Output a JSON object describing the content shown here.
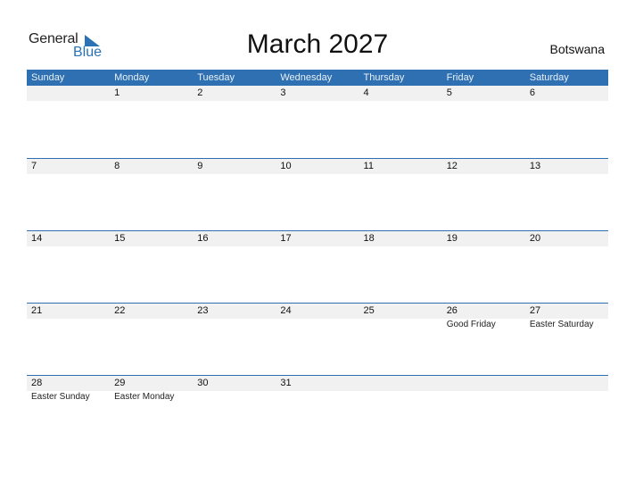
{
  "logo": {
    "word1": "General",
    "word2": "Blue"
  },
  "title": "March 2027",
  "country": "Botswana",
  "colors": {
    "accent": "#2e70b1",
    "strip": "#f1f1f1"
  },
  "weekdays": [
    "Sunday",
    "Monday",
    "Tuesday",
    "Wednesday",
    "Thursday",
    "Friday",
    "Saturday"
  ],
  "weeks": [
    [
      {
        "day": ""
      },
      {
        "day": "1"
      },
      {
        "day": "2"
      },
      {
        "day": "3"
      },
      {
        "day": "4"
      },
      {
        "day": "5"
      },
      {
        "day": "6"
      }
    ],
    [
      {
        "day": "7"
      },
      {
        "day": "8"
      },
      {
        "day": "9"
      },
      {
        "day": "10"
      },
      {
        "day": "11"
      },
      {
        "day": "12"
      },
      {
        "day": "13"
      }
    ],
    [
      {
        "day": "14"
      },
      {
        "day": "15"
      },
      {
        "day": "16"
      },
      {
        "day": "17"
      },
      {
        "day": "18"
      },
      {
        "day": "19"
      },
      {
        "day": "20"
      }
    ],
    [
      {
        "day": "21"
      },
      {
        "day": "22"
      },
      {
        "day": "23"
      },
      {
        "day": "24"
      },
      {
        "day": "25"
      },
      {
        "day": "26",
        "holiday": "Good Friday"
      },
      {
        "day": "27",
        "holiday": "Easter Saturday"
      }
    ],
    [
      {
        "day": "28",
        "holiday": "Easter Sunday"
      },
      {
        "day": "29",
        "holiday": "Easter Monday"
      },
      {
        "day": "30"
      },
      {
        "day": "31"
      },
      {
        "day": ""
      },
      {
        "day": ""
      },
      {
        "day": ""
      }
    ]
  ]
}
